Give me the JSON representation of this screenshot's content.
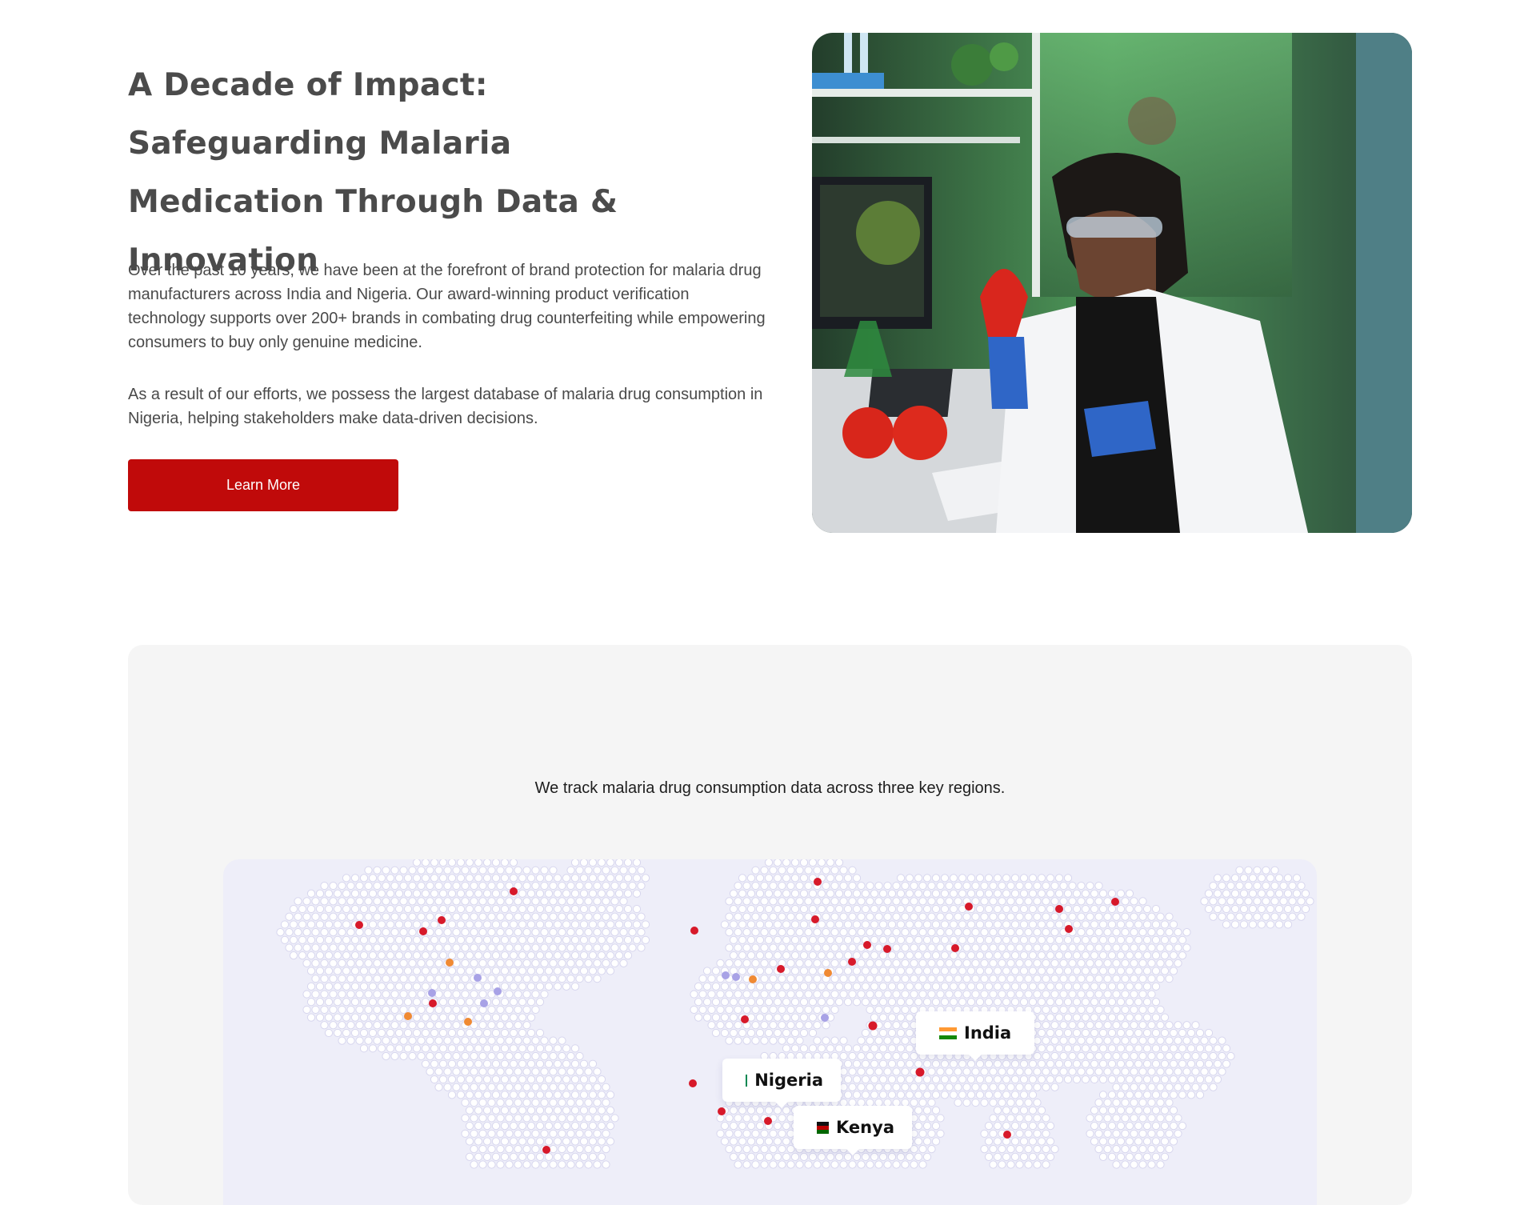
{
  "hero": {
    "title_lines": [
      "A Decade of Impact:",
      "Safeguarding Malaria",
      "Medication Through Data & Innovation"
    ],
    "paragraphs": [
      "Over the past 10 years, we have been at the forefront of brand protection for malaria drug manufacturers across India and Nigeria. Our award-winning product verification technology supports over 200+ brands in combating drug counterfeiting while empowering consumers to buy only genuine medicine.",
      "As a result of our efforts, we possess the largest database of malaria drug consumption in Nigeria, helping stakeholders make data-driven decisions."
    ],
    "cta_label": "Learn More"
  },
  "regions_section": {
    "caption": "We track malaria drug consumption data across three key regions.",
    "regions": [
      {
        "name": "India",
        "flag": "india-flag-icon"
      },
      {
        "name": "Nigeria",
        "flag": "nigeria-flag-icon"
      },
      {
        "name": "Kenya",
        "flag": "kenya-flag-icon"
      }
    ]
  },
  "colors": {
    "brand_red": "#c00a0a",
    "title_gray": "#4b4b4b",
    "map_background": "#eeeef9",
    "marker_red": "#d7192a",
    "marker_orange": "#f08a33",
    "marker_purple": "#a8a2e6"
  }
}
